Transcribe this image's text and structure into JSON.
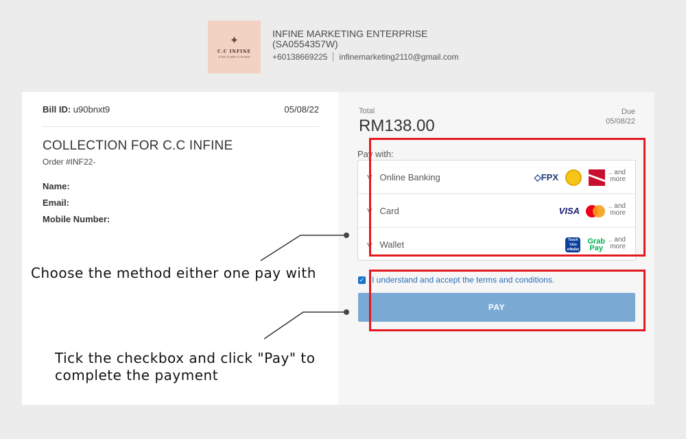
{
  "merchant": {
    "logo_name": "C.C INFINE",
    "logo_tagline": "A life of gifts & beauty",
    "name": "INFINE MARKETING ENTERPRISE",
    "registration": "(SA0554357W)",
    "phone": "+60138669225",
    "email": "infinemarketing2110@gmail.com"
  },
  "bill": {
    "id_label": "Bill ID:",
    "id_value": "u90bnxt9",
    "date": "05/08/22",
    "collection_title": "COLLECTION FOR C.C INFINE",
    "order_number": "Order #INF22-",
    "name_label": "Name:",
    "email_label": "Email:",
    "mobile_label": "Mobile Number:"
  },
  "summary": {
    "total_label": "Total",
    "total_amount": "RM138.00",
    "due_label": "Due",
    "due_date": "05/08/22"
  },
  "payment": {
    "pay_with_label": "Pay with:",
    "methods": [
      {
        "label": "Online Banking",
        "logos": [
          "fpx-icon",
          "maybank-icon",
          "cimb-icon"
        ],
        "fpx_text": "FPX",
        "more_1": ".. and",
        "more_2": "more"
      },
      {
        "label": "Card",
        "logos": [
          "visa-icon",
          "mastercard-icon"
        ],
        "visa_text": "VISA",
        "more_1": ".. and",
        "more_2": "more"
      },
      {
        "label": "Wallet",
        "logos": [
          "touch-n-go-icon",
          "grabpay-icon"
        ],
        "tng_1": "Touch",
        "tng_2": "'nGo",
        "tng_3": "eWallet",
        "grab_1": "Grab",
        "grab_2": "Pay",
        "more_1": ".. and",
        "more_2": "more"
      }
    ],
    "terms_text": "I understand and accept the terms and conditions.",
    "terms_checked": true,
    "pay_button": "PAY"
  },
  "annotations": {
    "choose_method": "Choose the method either one pay with",
    "tick_line1": "Tick the checkbox and click \"Pay\" to",
    "tick_line2": "complete the payment"
  },
  "colors": {
    "highlight": "#e3191f",
    "pay_button": "#7aa9d3",
    "link": "#2a6db5",
    "background": "#ececec"
  }
}
